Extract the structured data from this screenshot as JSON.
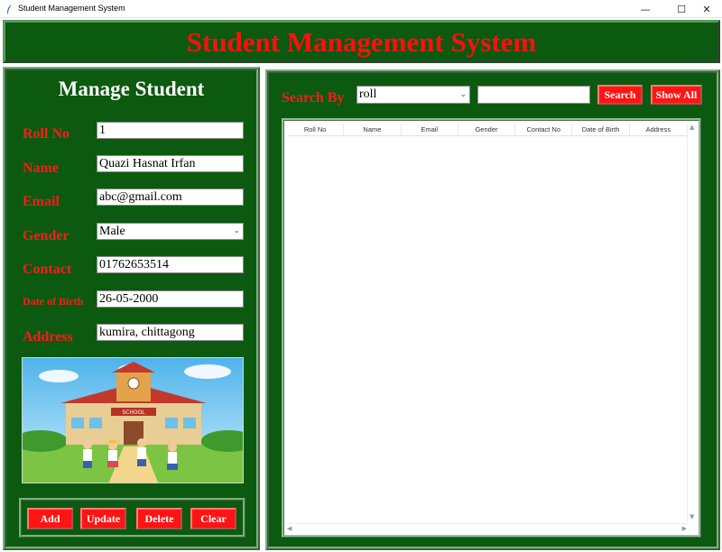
{
  "window": {
    "title": "Student Management System",
    "minimize_glyph": "—",
    "maximize_glyph": "☐",
    "close_glyph": "✕"
  },
  "header": {
    "title": "Student Management System"
  },
  "manage": {
    "title": "Manage Student",
    "labels": {
      "roll": "Roll No",
      "name": "Name",
      "email": "Email",
      "gender": "Gender",
      "contact": "Contact",
      "dob": "Date of Birth",
      "address": "Address"
    },
    "values": {
      "roll": "1",
      "name": "Quazi Hasnat Irfan",
      "email": "abc@gmail.com",
      "gender": "Male",
      "contact": "01762653514",
      "dob": "26-05-2000",
      "address": "kumira, chittagong"
    },
    "school_sign": "SCHOOL",
    "buttons": {
      "add": "Add",
      "update": "Update",
      "delete": "Delete",
      "clear": "Clear"
    }
  },
  "search": {
    "label": "Search By",
    "by_value": "roll",
    "text_value": "",
    "search_button": "Search",
    "show_all_button": "Show All"
  },
  "table": {
    "columns": [
      "Roll No",
      "Name",
      "Email",
      "Gender",
      "Contact No",
      "Date of Birth",
      "Address"
    ],
    "rows": []
  },
  "colors": {
    "panel_green": "#0b5a10",
    "accent_red": "#ff1414",
    "title_red": "#ff0f0f"
  },
  "icons": {
    "window": "feather-icon",
    "chevron": "chevron-down-icon"
  }
}
